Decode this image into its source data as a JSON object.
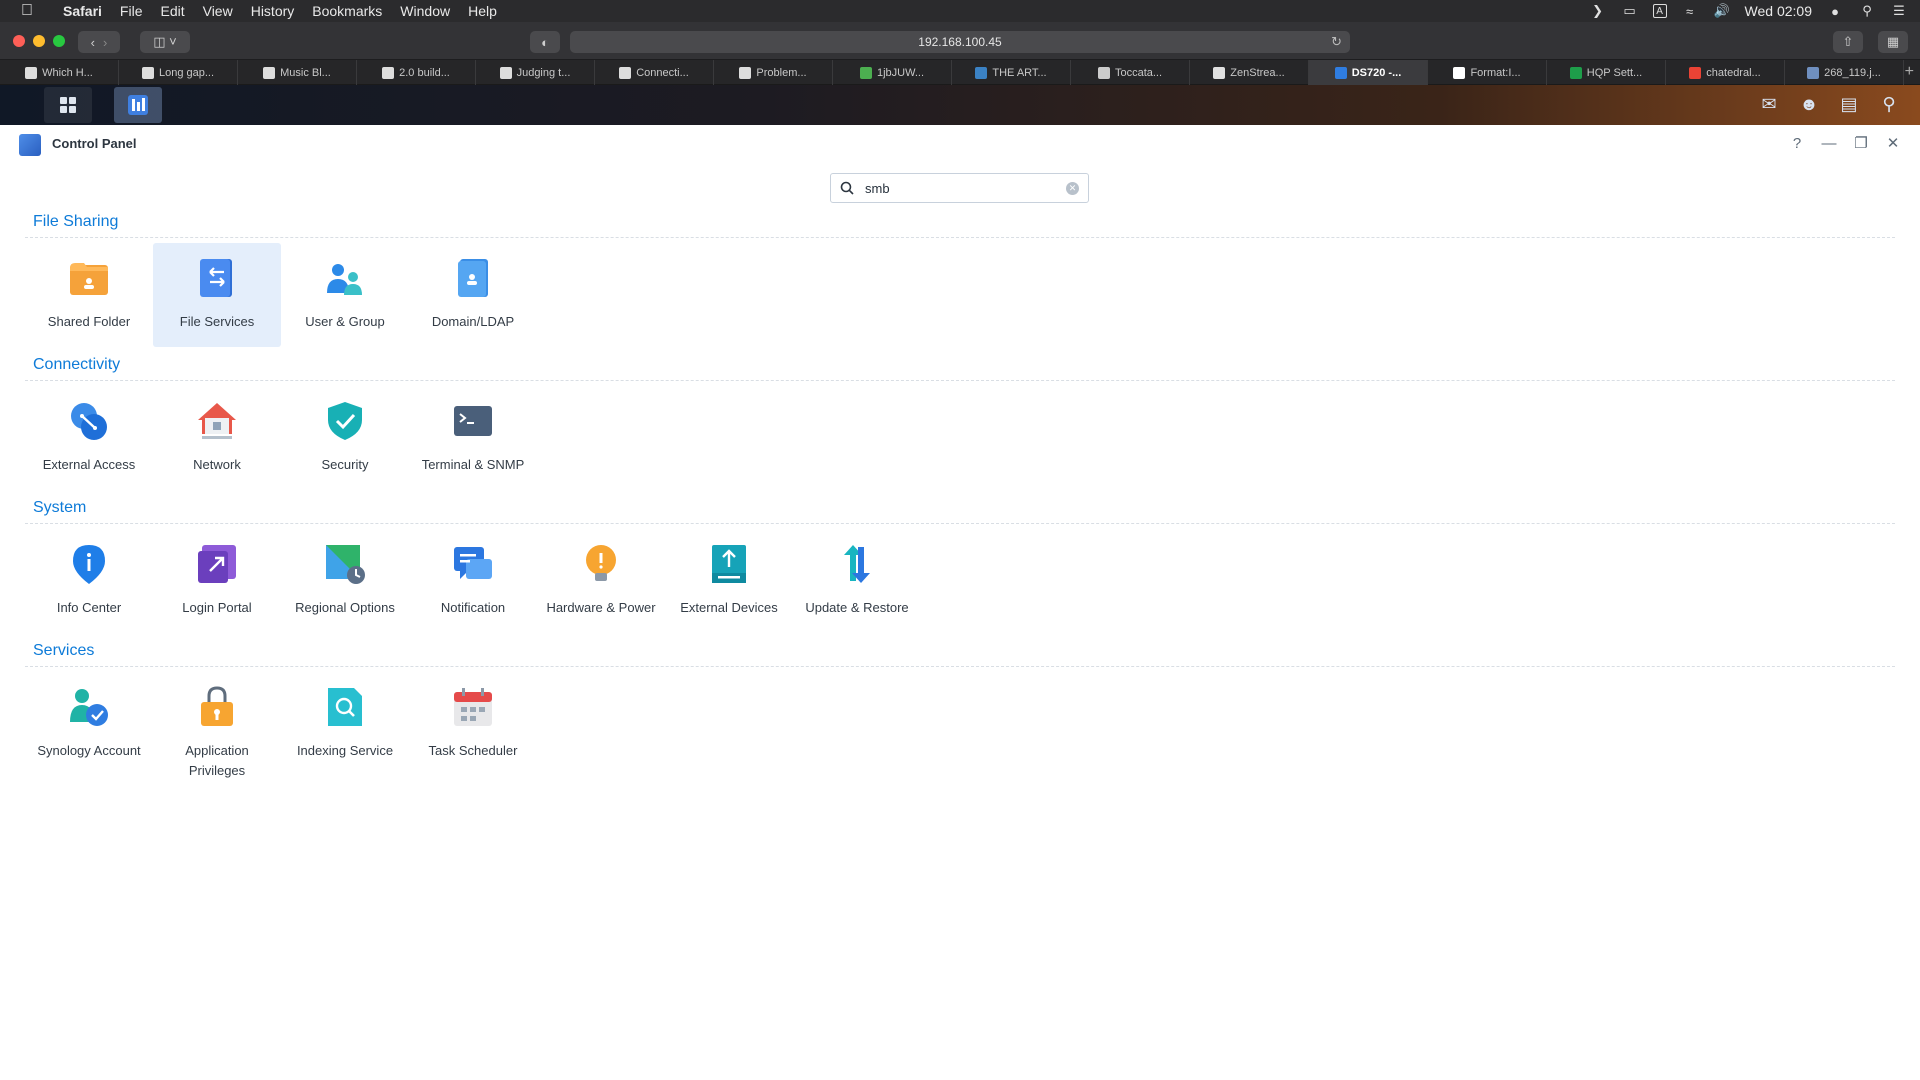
{
  "menubar": {
    "app": "Safari",
    "items": [
      "File",
      "Edit",
      "View",
      "History",
      "Bookmarks",
      "Window",
      "Help"
    ],
    "clock": "Wed 02:09"
  },
  "browser": {
    "url": "192.168.100.45",
    "tabs": [
      {
        "label": "Which H...",
        "color": "#dddddd"
      },
      {
        "label": "Long gap...",
        "color": "#dddddd"
      },
      {
        "label": "Music Bl...",
        "color": "#dddddd"
      },
      {
        "label": "2.0 build...",
        "color": "#dddddd"
      },
      {
        "label": "Judging t...",
        "color": "#dddddd"
      },
      {
        "label": "Connecti...",
        "color": "#dddddd"
      },
      {
        "label": "Problem...",
        "color": "#dddddd"
      },
      {
        "label": "1jbJUW...",
        "color": "#4caf50"
      },
      {
        "label": "THE ART...",
        "color": "#3b82c4"
      },
      {
        "label": "Toccata...",
        "color": "#cccccc"
      },
      {
        "label": "ZenStrea...",
        "color": "#e0e0e0"
      },
      {
        "label": "DS720 -...",
        "color": "#2f7de1",
        "active": true
      },
      {
        "label": "Format:I...",
        "color": "#ffffff"
      },
      {
        "label": "HQP Sett...",
        "color": "#1e9e4a"
      },
      {
        "label": "chatedral...",
        "color": "#ea4335"
      },
      {
        "label": "268_119.j...",
        "color": "#6f8fbf"
      }
    ]
  },
  "window": {
    "title": "Control Panel",
    "search": {
      "value": "smb",
      "placeholder": "Search"
    }
  },
  "sections": [
    {
      "title": "File Sharing",
      "items": [
        {
          "label": "Shared Folder",
          "icon": "shared-folder-icon"
        },
        {
          "label": "File Services",
          "icon": "file-services-icon",
          "selected": true
        },
        {
          "label": "User & Group",
          "icon": "user-group-icon"
        },
        {
          "label": "Domain/LDAP",
          "icon": "domain-ldap-icon"
        }
      ]
    },
    {
      "title": "Connectivity",
      "items": [
        {
          "label": "External Access",
          "icon": "external-access-icon"
        },
        {
          "label": "Network",
          "icon": "network-icon"
        },
        {
          "label": "Security",
          "icon": "security-shield-icon"
        },
        {
          "label": "Terminal & SNMP",
          "icon": "terminal-icon"
        }
      ]
    },
    {
      "title": "System",
      "items": [
        {
          "label": "Info Center",
          "icon": "info-center-icon"
        },
        {
          "label": "Login Portal",
          "icon": "login-portal-icon"
        },
        {
          "label": "Regional Options",
          "icon": "regional-options-icon"
        },
        {
          "label": "Notification",
          "icon": "notification-icon"
        },
        {
          "label": "Hardware & Power",
          "icon": "hardware-power-icon"
        },
        {
          "label": "External Devices",
          "icon": "external-devices-icon"
        },
        {
          "label": "Update & Restore",
          "icon": "update-restore-icon"
        }
      ]
    },
    {
      "title": "Services",
      "items": [
        {
          "label": "Synology Account",
          "icon": "synology-account-icon"
        },
        {
          "label": "Application Privileges",
          "icon": "application-privileges-icon"
        },
        {
          "label": "Indexing Service",
          "icon": "indexing-service-icon"
        },
        {
          "label": "Task Scheduler",
          "icon": "task-scheduler-icon"
        }
      ]
    }
  ]
}
